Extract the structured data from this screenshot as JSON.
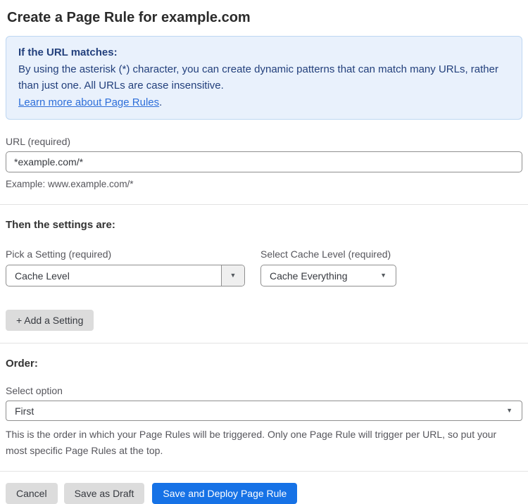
{
  "page": {
    "title": "Create a Page Rule for example.com"
  },
  "info_box": {
    "heading": "If the URL matches:",
    "body": "By using the asterisk (*) character, you can create dynamic patterns that can match many URLs, rather than just one. All URLs are case insensitive.",
    "link_label": "Learn more about Page Rules",
    "link_suffix": "."
  },
  "url_field": {
    "label": "URL (required)",
    "value": "*example.com/*",
    "hint": "Example: www.example.com/*"
  },
  "settings_section": {
    "heading": "Then the settings are:",
    "pick_setting": {
      "label": "Pick a Setting (required)",
      "value": "Cache Level"
    },
    "cache_level": {
      "label": "Select Cache Level (required)",
      "value": "Cache Everything"
    },
    "add_button_label": "+ Add a Setting"
  },
  "order_section": {
    "heading": "Order:",
    "label": "Select option",
    "value": "First",
    "hint": "This is the order in which your Page Rules will be triggered. Only one Page Rule will trigger per URL, so put your most specific Page Rules at the top."
  },
  "footer": {
    "cancel_label": "Cancel",
    "save_draft_label": "Save as Draft",
    "save_deploy_label": "Save and Deploy Page Rule"
  },
  "icons": {
    "caret_down": "▼"
  },
  "colors": {
    "accent_blue": "#1672e6",
    "info_background": "#e9f1fc",
    "info_border": "#bed7f2",
    "info_text": "#23407c",
    "link_blue": "#2d6ed9",
    "button_gray": "#dcdcdc"
  }
}
